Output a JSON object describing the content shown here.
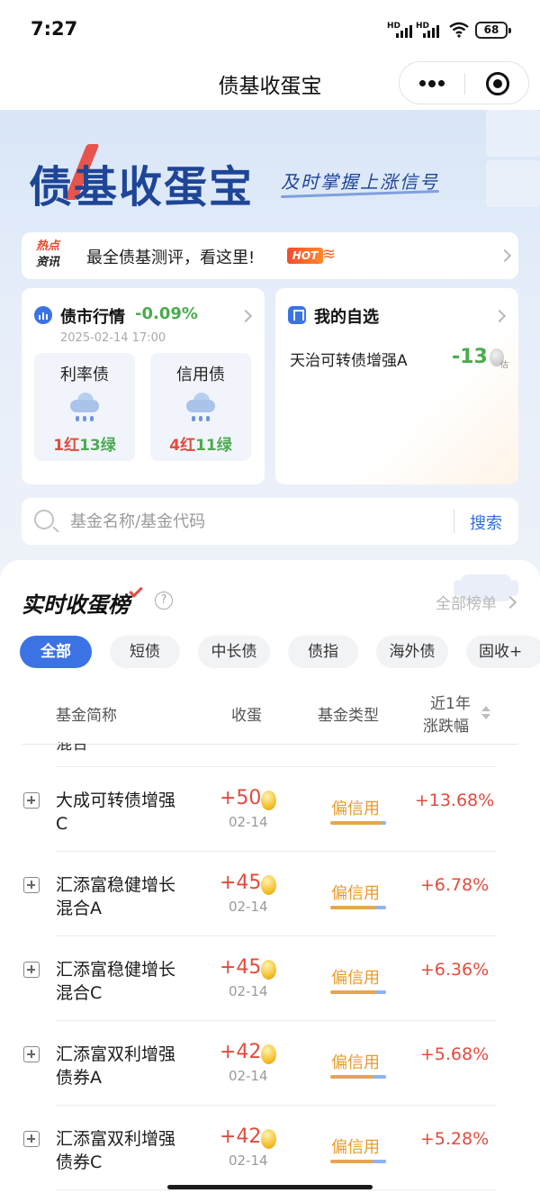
{
  "status_bar": {
    "time": "7:27",
    "sim1": "HD",
    "sim2": "HD",
    "battery": "68"
  },
  "nav": {
    "title": "债基收蛋宝"
  },
  "banner": {
    "logo": "债基收蛋宝",
    "slogan": "及时掌握上涨信号",
    "hot": {
      "tag_line1": "热点",
      "tag_line2": "资讯",
      "text": "最全债基测评，看这里!",
      "badge": "HOT"
    }
  },
  "market": {
    "title": "债市行情",
    "change": "-0.09%",
    "date": "2025-02-14 17:00",
    "items": [
      {
        "name": "利率债",
        "red": "1红",
        "green": "13绿"
      },
      {
        "name": "信用债",
        "red": "4红",
        "green": "11绿"
      }
    ]
  },
  "favorites": {
    "title": "我的自选",
    "fund": "天治可转债增强A",
    "value": "-13",
    "badge": "估"
  },
  "search": {
    "placeholder": "基金名称/基金代码",
    "button": "搜索"
  },
  "ranking": {
    "title": "实时收蛋榜",
    "help": "?",
    "all": "全部榜单",
    "tabs": [
      "全部",
      "短债",
      "中长债",
      "债指",
      "海外债",
      "固收+"
    ],
    "active_tab": "全部",
    "headers": {
      "name": "基金简称",
      "eggs": "收蛋",
      "type": "基金类型",
      "change_line1": "近1年",
      "change_line2": "涨跌幅"
    },
    "partial_row_text": "混合",
    "rows": [
      {
        "name": "大成可转债增强C",
        "eggs": "+50",
        "date": "02-14",
        "type": "偏信用",
        "change": "+13.68%",
        "bar_fill": 0.92
      },
      {
        "name": "汇添富稳健增长混合A",
        "eggs": "+45",
        "date": "02-14",
        "type": "偏信用",
        "change": "+6.78%",
        "bar_fill": 0.82
      },
      {
        "name": "汇添富稳健增长混合C",
        "eggs": "+45",
        "date": "02-14",
        "type": "偏信用",
        "change": "+6.36%",
        "bar_fill": 0.82
      },
      {
        "name": "汇添富双利增强债券A",
        "eggs": "+42",
        "date": "02-14",
        "type": "偏信用",
        "change": "+5.68%",
        "bar_fill": 0.76
      },
      {
        "name": "汇添富双利增强债券C",
        "eggs": "+42",
        "date": "02-14",
        "type": "偏信用",
        "change": "+5.28%",
        "bar_fill": 0.76
      }
    ]
  },
  "colors": {
    "accent": "#3b73e5",
    "up": "#e34b3d",
    "down": "#4cab4f",
    "credit": "#e89b2b"
  }
}
